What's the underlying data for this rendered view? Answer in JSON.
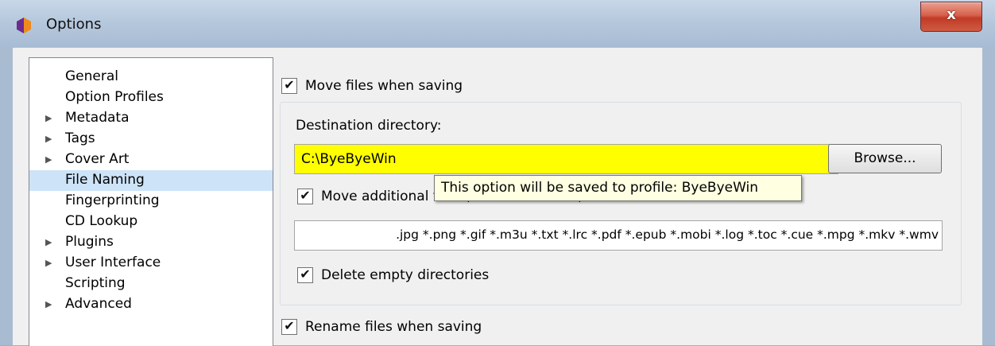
{
  "window": {
    "title": "Options",
    "close_label": "x",
    "app_icon": "app-logo-icon"
  },
  "nav": {
    "items": [
      {
        "label": "General",
        "expandable": false,
        "selected": false
      },
      {
        "label": "Option Profiles",
        "expandable": false,
        "selected": false
      },
      {
        "label": "Metadata",
        "expandable": true,
        "selected": false
      },
      {
        "label": "Tags",
        "expandable": true,
        "selected": false
      },
      {
        "label": "Cover Art",
        "expandable": true,
        "selected": false
      },
      {
        "label": "File Naming",
        "expandable": false,
        "selected": true
      },
      {
        "label": "Fingerprinting",
        "expandable": false,
        "selected": false
      },
      {
        "label": "CD Lookup",
        "expandable": false,
        "selected": false
      },
      {
        "label": "Plugins",
        "expandable": true,
        "selected": false
      },
      {
        "label": "User Interface",
        "expandable": true,
        "selected": false
      },
      {
        "label": "Scripting",
        "expandable": false,
        "selected": false
      },
      {
        "label": "Advanced",
        "expandable": true,
        "selected": false
      }
    ]
  },
  "file_naming": {
    "move_files": {
      "label": "Move files when saving",
      "checked": true
    },
    "destination": {
      "label": "Destination directory:",
      "value": "C:\\ByeByeWin",
      "highlight_color": "#ffff00"
    },
    "browse_label": "Browse...",
    "tooltip": "This option will be saved to profile: ByeByeWin",
    "move_additional": {
      "label": "Move additional files (case insensitive):",
      "checked": true
    },
    "additional_patterns": ".jpg *.png *.gif *.m3u *.txt *.lrc *.pdf *.epub *.mobi *.log *.toc *.cue *.mpg *.mkv *.wmv",
    "delete_empty": {
      "label": "Delete empty directories",
      "checked": true
    },
    "rename_files": {
      "label": "Rename files when saving",
      "checked": true
    }
  },
  "colors": {
    "selection": "#cde3f8",
    "tooltip_bg": "#ffffe1",
    "close_button": "#c94a35"
  }
}
